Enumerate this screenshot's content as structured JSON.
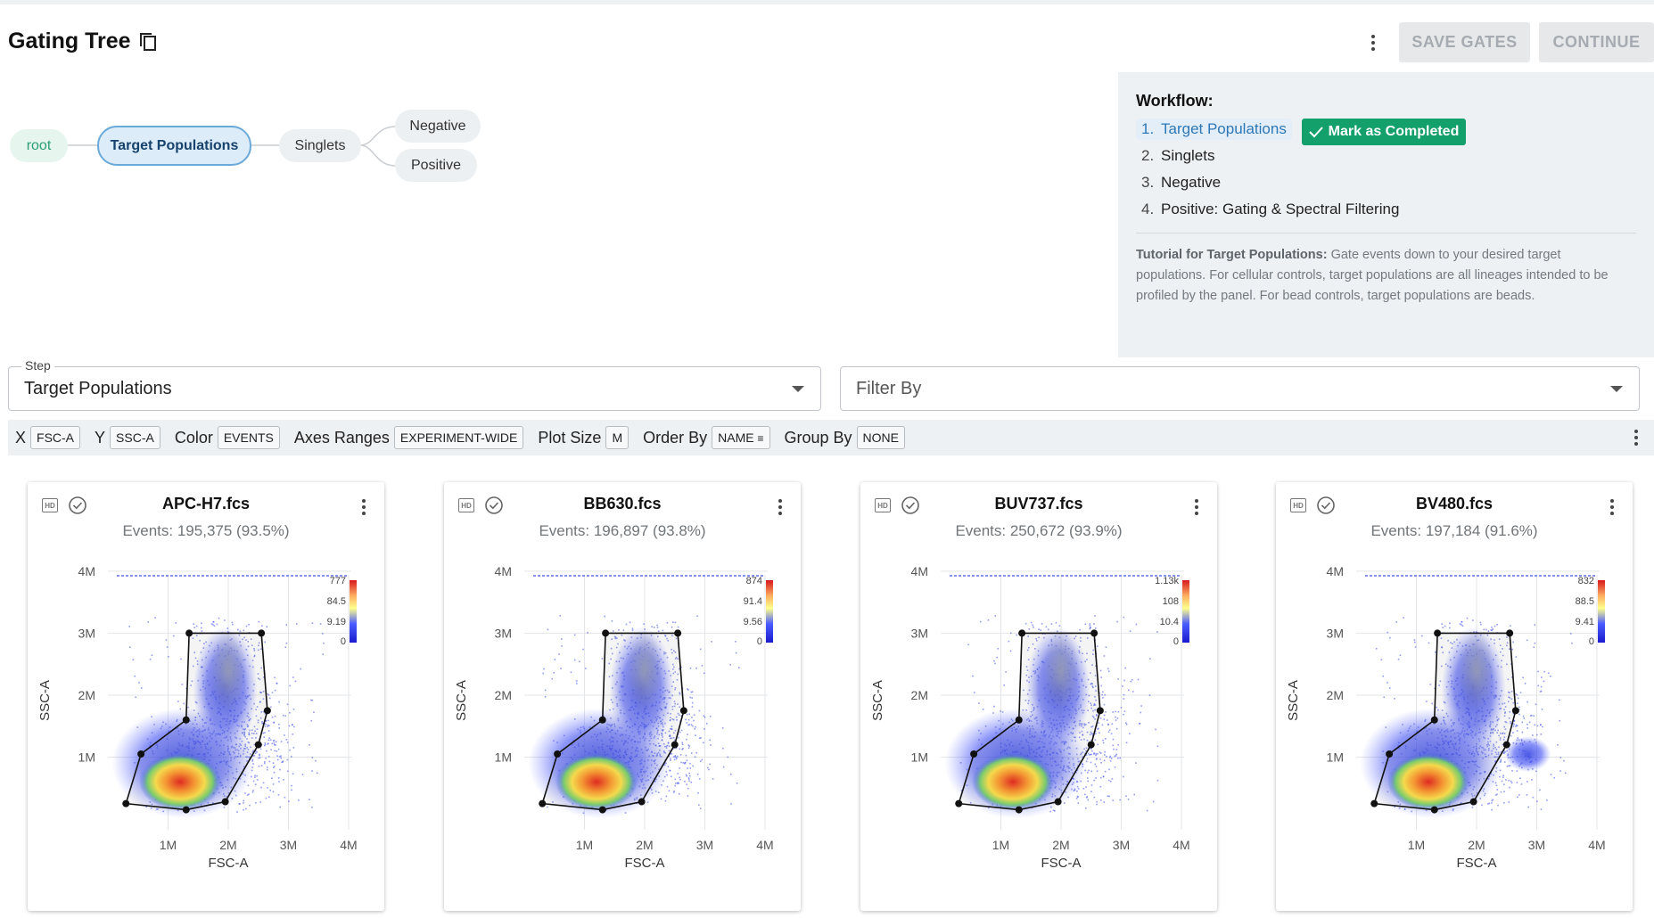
{
  "header": {
    "title": "Gating Tree",
    "save_label": "SAVE GATES",
    "continue_label": "CONTINUE"
  },
  "tree": {
    "nodes": [
      "root",
      "Target Populations",
      "Singlets",
      "Negative",
      "Positive"
    ]
  },
  "workflow": {
    "title": "Workflow:",
    "steps": [
      {
        "num": "1.",
        "label": "Target Populations"
      },
      {
        "num": "2.",
        "label": "Singlets"
      },
      {
        "num": "3.",
        "label": "Negative"
      },
      {
        "num": "4.",
        "label": "Positive: Gating & Spectral Filtering"
      }
    ],
    "mark_label": "Mark as Completed",
    "tutorial_bold": "Tutorial for Target Populations:",
    "tutorial_text": " Gate events down to your desired target populations. For cellular controls, target populations are all lineages intended to be profiled by the panel. For bead controls, target populations are beads."
  },
  "step_field": {
    "label": "Step",
    "value": "Target Populations"
  },
  "filter_field": {
    "placeholder": "Filter By"
  },
  "toolbar": {
    "x_label": "X",
    "x_value": "FSC-A",
    "y_label": "Y",
    "y_value": "SSC-A",
    "color_label": "Color",
    "color_value": "EVENTS",
    "axes_label": "Axes Ranges",
    "axes_value": "EXPERIMENT-WIDE",
    "size_label": "Plot Size",
    "size_value": "M",
    "order_label": "Order By",
    "order_value": "NAME",
    "group_label": "Group By",
    "group_value": "NONE"
  },
  "cards": [
    {
      "title": "APC-H7.fcs",
      "events": "Events: 195,375 (93.5%)",
      "scale": [
        "777",
        "84.5",
        "9.19",
        "0"
      ]
    },
    {
      "title": "BB630.fcs",
      "events": "Events: 196,897 (93.8%)",
      "scale": [
        "874",
        "91.4",
        "9.56",
        "0"
      ]
    },
    {
      "title": "BUV737.fcs",
      "events": "Events: 250,672 (93.9%)",
      "scale": [
        "1.13k",
        "108",
        "10.4",
        "0"
      ]
    },
    {
      "title": "BV480.fcs",
      "events": "Events: 197,184 (91.6%)",
      "scale": [
        "832",
        "88.5",
        "9.41",
        "0"
      ]
    }
  ],
  "plot_axes": {
    "x_label": "FSC-A",
    "y_label": "SSC-A",
    "x_ticks": [
      "1M",
      "2M",
      "3M",
      "4M"
    ],
    "y_ticks": [
      "4M",
      "3M",
      "2M",
      "1M"
    ]
  },
  "gate_polygon": [
    [
      0.3,
      0.25
    ],
    [
      1.3,
      0.18
    ],
    [
      2.3,
      1.2
    ],
    [
      2.4,
      3.0
    ],
    [
      1.3,
      1.6
    ],
    [
      0.5,
      1.05
    ]
  ],
  "colors": {
    "accent": "#2d78b6",
    "success": "#14a06b",
    "panel": "#eef1f4"
  }
}
